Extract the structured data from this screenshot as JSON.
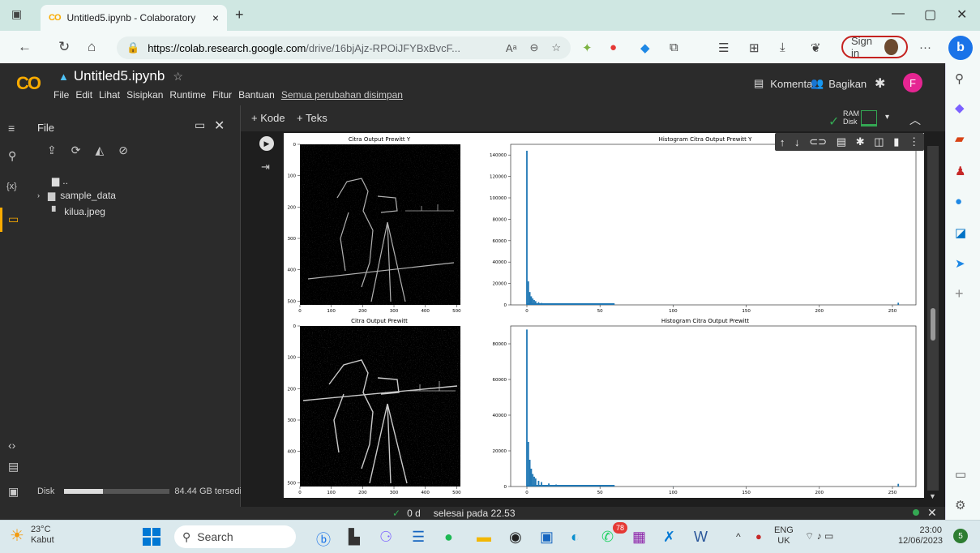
{
  "browser": {
    "tab_title": "Untitled5.ipynb - Colaboratory",
    "tab_logo": "CO",
    "tab_close": "×",
    "new_tab": "+",
    "url_host": "https://colab.research.google.com",
    "url_path": "/drive/16bjAjz-RPOiJFYBxBvcF...",
    "reader": "Aᵃ",
    "sign_in": "Sign in",
    "more": "···",
    "window": {
      "min": "—",
      "max": "▢",
      "close": "✕"
    }
  },
  "colab": {
    "logo": "CO",
    "title": "Untitled5.ipynb",
    "menu": [
      "File",
      "Edit",
      "Lihat",
      "Sisipkan",
      "Runtime",
      "Fitur",
      "Bantuan"
    ],
    "saved_status": "Semua perubahan disimpan",
    "comment_label": "Komentar",
    "share_label": "Bagikan",
    "user_initial": "F",
    "add_code": "+ Kode",
    "add_text": "+ Teks",
    "ram_label": "RAM",
    "disk_label": "Disk"
  },
  "file_panel": {
    "title": "File",
    "parent": "..",
    "items": [
      {
        "name": "sample_data",
        "type": "folder"
      },
      {
        "name": "kilua.jpeg",
        "type": "file"
      }
    ],
    "disk_label": "Disk",
    "disk_free": "84.44 GB tersedia"
  },
  "status_bar": {
    "check": "✓",
    "duration": "0 d",
    "completed": "selesai pada 22.53"
  },
  "figures": {
    "img_y_title": "Citra Output Prewitt Y",
    "img_title": "Citra Output Prewitt",
    "hist_y_title": "Histogram Citra Output Prewitt Y",
    "hist_title": "Histogram Citra Output Prewitt",
    "img_xticks": [
      "0",
      "100",
      "200",
      "300",
      "400",
      "500"
    ],
    "img_y_yticks": [
      "0",
      "100",
      "200",
      "300",
      "400",
      "500"
    ],
    "img_yticks": [
      "0",
      "100",
      "200",
      "300",
      "400",
      "500"
    ],
    "hist_xticks": [
      "0",
      "50",
      "100",
      "150",
      "200",
      "250"
    ],
    "hist_y_yticks": [
      "0",
      "20000",
      "40000",
      "60000",
      "80000",
      "100000",
      "120000",
      "140000"
    ],
    "hist_yticks": [
      "0",
      "20000",
      "40000",
      "60000",
      "80000"
    ]
  },
  "chart_data": [
    {
      "type": "bar",
      "title": "Histogram Citra Output Prewitt Y",
      "xlim": [
        0,
        255
      ],
      "ylim": [
        0,
        150000
      ],
      "x": [
        0,
        1,
        2,
        3,
        4,
        5,
        6,
        8,
        10,
        15,
        20,
        30,
        50,
        100,
        254
      ],
      "values": [
        144000,
        22000,
        12000,
        8000,
        6000,
        4500,
        3500,
        2500,
        1800,
        1200,
        800,
        500,
        200,
        60,
        2000
      ]
    },
    {
      "type": "bar",
      "title": "Histogram Citra Output Prewitt",
      "xlim": [
        0,
        255
      ],
      "ylim": [
        0,
        90000
      ],
      "x": [
        0,
        1,
        2,
        3,
        4,
        5,
        6,
        8,
        10,
        15,
        20,
        30,
        50,
        100,
        254
      ],
      "values": [
        88000,
        25000,
        15000,
        10000,
        7000,
        5500,
        4500,
        3200,
        2500,
        1700,
        1100,
        700,
        300,
        80,
        1500
      ]
    }
  ],
  "taskbar": {
    "weather_temp": "23°C",
    "weather_desc": "Kabut",
    "search": "Search",
    "lang_top": "ENG",
    "lang_bottom": "UK",
    "time": "23:00",
    "date": "12/06/2023",
    "notif_count": "5",
    "badge": "78"
  }
}
